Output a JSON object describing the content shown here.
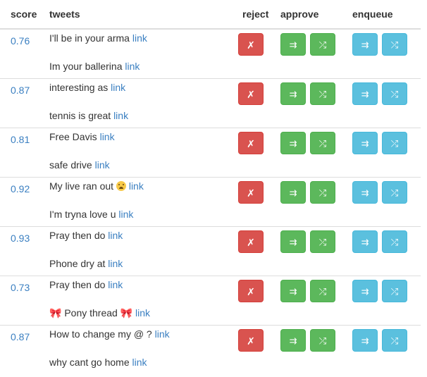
{
  "header": {
    "score": "score",
    "tweets": "tweets",
    "reject": "reject",
    "approve": "approve",
    "enqueue": "enqueue"
  },
  "buttons": {
    "reject_glyph": "✗",
    "approve_next_glyph": "⇉",
    "approve_shuffle_glyph": "⤮",
    "enqueue_next_glyph": "⇉",
    "enqueue_shuffle_glyph": "⤮"
  },
  "colors": {
    "reject": "#d9534f",
    "approve": "#5cb85c",
    "enqueue": "#5bc0de",
    "link": "#3a7fc1"
  },
  "link_label": "link",
  "rows": [
    {
      "score": "0.76",
      "line1": "I'll be in your arma",
      "line2": "Im your ballerina"
    },
    {
      "score": "0.87",
      "line1": "interesting as",
      "line2": "tennis is great"
    },
    {
      "score": "0.81",
      "line1": "Free Davis",
      "line2": "safe drive"
    },
    {
      "score": "0.92",
      "line1": "My live ran out",
      "line1_emoji": "weary-face-emoji",
      "line2": "I'm tryna love u"
    },
    {
      "score": "0.93",
      "line1": "Pray then do",
      "line2": "Phone dry at"
    },
    {
      "score": "0.73",
      "line1": "Pray then do",
      "line2": "Pony thread",
      "line2_emoji": "ribbon-emoji"
    },
    {
      "score": "0.87",
      "line1": "How to change my @ ?",
      "line2": "why cant go home"
    }
  ]
}
